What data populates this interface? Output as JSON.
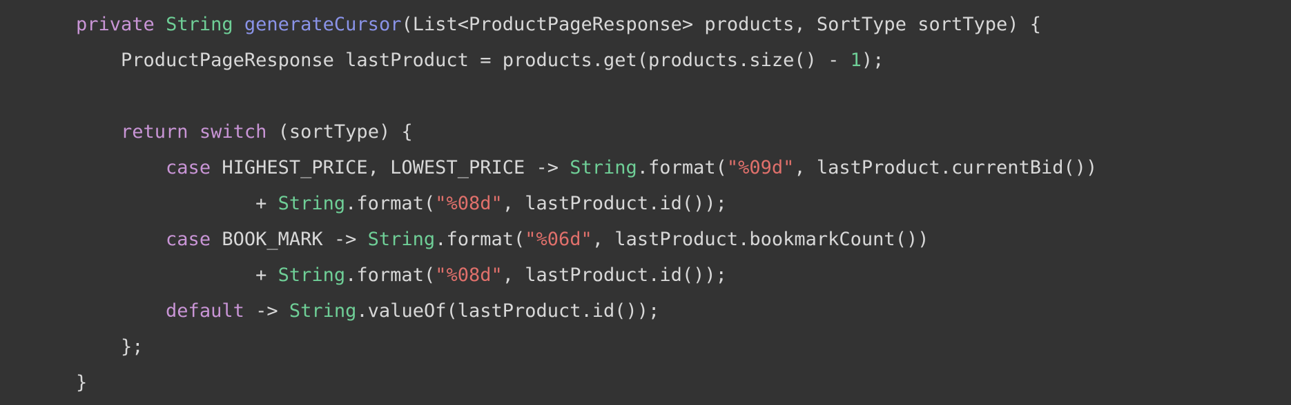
{
  "colors": {
    "background": "#333333",
    "plain": "#d8d8d8",
    "keyword": "#c995d6",
    "type": "#6fcf97",
    "method": "#8a93e8",
    "number": "#6fcf97",
    "string": "#e0706b"
  },
  "code_lines": [
    [
      {
        "t": "private",
        "k": "keyword"
      },
      {
        "t": " ",
        "k": "plain"
      },
      {
        "t": "String",
        "k": "type"
      },
      {
        "t": " ",
        "k": "plain"
      },
      {
        "t": "generateCursor",
        "k": "method"
      },
      {
        "t": "(List<ProductPageResponse> products, SortType sortType) {",
        "k": "plain"
      }
    ],
    [
      {
        "t": "    ProductPageResponse lastProduct = products.get(products.size() - ",
        "k": "plain"
      },
      {
        "t": "1",
        "k": "number"
      },
      {
        "t": ");",
        "k": "plain"
      }
    ],
    [],
    [
      {
        "t": "    ",
        "k": "plain"
      },
      {
        "t": "return",
        "k": "keyword"
      },
      {
        "t": " ",
        "k": "plain"
      },
      {
        "t": "switch",
        "k": "keyword"
      },
      {
        "t": " (sortType) {",
        "k": "plain"
      }
    ],
    [
      {
        "t": "        ",
        "k": "plain"
      },
      {
        "t": "case",
        "k": "keyword"
      },
      {
        "t": " HIGHEST_PRICE, LOWEST_PRICE -> ",
        "k": "plain"
      },
      {
        "t": "String",
        "k": "type"
      },
      {
        "t": ".format(",
        "k": "plain"
      },
      {
        "t": "\"%09d\"",
        "k": "string"
      },
      {
        "t": ", lastProduct.currentBid())",
        "k": "plain"
      }
    ],
    [
      {
        "t": "                + ",
        "k": "plain"
      },
      {
        "t": "String",
        "k": "type"
      },
      {
        "t": ".format(",
        "k": "plain"
      },
      {
        "t": "\"%08d\"",
        "k": "string"
      },
      {
        "t": ", lastProduct.id());",
        "k": "plain"
      }
    ],
    [
      {
        "t": "        ",
        "k": "plain"
      },
      {
        "t": "case",
        "k": "keyword"
      },
      {
        "t": " BOOK_MARK -> ",
        "k": "plain"
      },
      {
        "t": "String",
        "k": "type"
      },
      {
        "t": ".format(",
        "k": "plain"
      },
      {
        "t": "\"%06d\"",
        "k": "string"
      },
      {
        "t": ", lastProduct.bookmarkCount())",
        "k": "plain"
      }
    ],
    [
      {
        "t": "                + ",
        "k": "plain"
      },
      {
        "t": "String",
        "k": "type"
      },
      {
        "t": ".format(",
        "k": "plain"
      },
      {
        "t": "\"%08d\"",
        "k": "string"
      },
      {
        "t": ", lastProduct.id());",
        "k": "plain"
      }
    ],
    [
      {
        "t": "        ",
        "k": "plain"
      },
      {
        "t": "default",
        "k": "keyword"
      },
      {
        "t": " -> ",
        "k": "plain"
      },
      {
        "t": "String",
        "k": "type"
      },
      {
        "t": ".valueOf(lastProduct.id());",
        "k": "plain"
      }
    ],
    [
      {
        "t": "    };",
        "k": "plain"
      }
    ],
    [
      {
        "t": "}",
        "k": "plain"
      }
    ]
  ]
}
